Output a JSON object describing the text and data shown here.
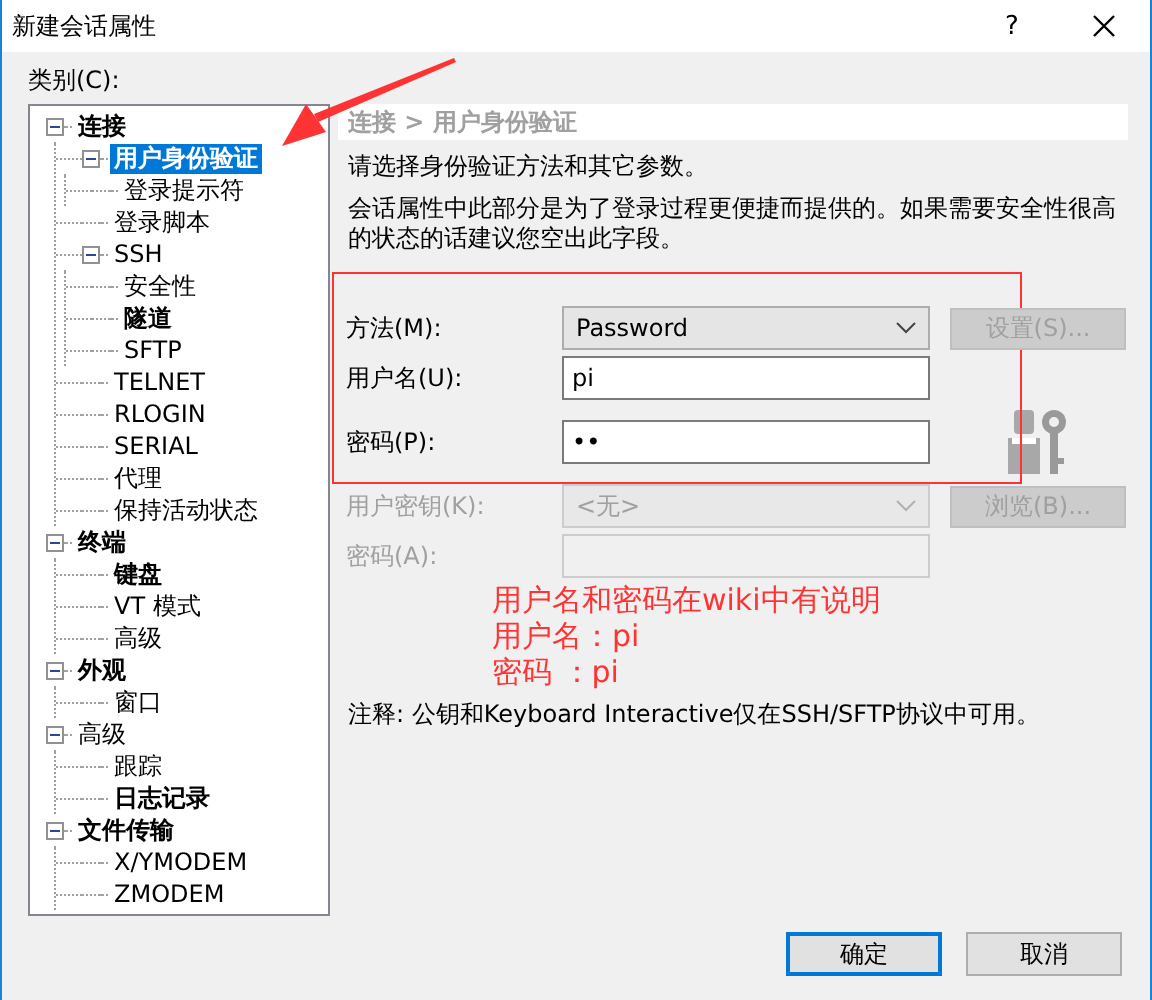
{
  "window": {
    "title": "新建会话属性",
    "help": "?"
  },
  "category_label": "类别(C):",
  "tree": [
    {
      "label": "连接",
      "bold": true,
      "selected": false,
      "expanded": true,
      "children": [
        {
          "label": "用户身份验证",
          "bold": true,
          "selected": true,
          "expanded": true,
          "children": [
            {
              "label": "登录提示符",
              "bold": false,
              "selected": false
            }
          ]
        },
        {
          "label": "登录脚本",
          "bold": false,
          "selected": false
        },
        {
          "label": "SSH",
          "bold": false,
          "selected": false,
          "expanded": true,
          "children": [
            {
              "label": "安全性",
              "bold": false,
              "selected": false
            },
            {
              "label": "隧道",
              "bold": true,
              "selected": false
            },
            {
              "label": "SFTP",
              "bold": false,
              "selected": false
            }
          ]
        },
        {
          "label": "TELNET",
          "bold": false,
          "selected": false
        },
        {
          "label": "RLOGIN",
          "bold": false,
          "selected": false
        },
        {
          "label": "SERIAL",
          "bold": false,
          "selected": false
        },
        {
          "label": "代理",
          "bold": false,
          "selected": false
        },
        {
          "label": "保持活动状态",
          "bold": false,
          "selected": false
        }
      ]
    },
    {
      "label": "终端",
      "bold": true,
      "selected": false,
      "expanded": true,
      "children": [
        {
          "label": "键盘",
          "bold": true,
          "selected": false
        },
        {
          "label": "VT 模式",
          "bold": false,
          "selected": false
        },
        {
          "label": "高级",
          "bold": false,
          "selected": false
        }
      ]
    },
    {
      "label": "外观",
      "bold": true,
      "selected": false,
      "expanded": true,
      "children": [
        {
          "label": "窗口",
          "bold": false,
          "selected": false
        }
      ]
    },
    {
      "label": "高级",
      "bold": false,
      "selected": false,
      "expanded": true,
      "children": [
        {
          "label": "跟踪",
          "bold": false,
          "selected": false
        },
        {
          "label": "日志记录",
          "bold": true,
          "selected": false
        }
      ]
    },
    {
      "label": "文件传输",
      "bold": true,
      "selected": false,
      "expanded": true,
      "children": [
        {
          "label": "X/YMODEM",
          "bold": false,
          "selected": false
        },
        {
          "label": "ZMODEM",
          "bold": false,
          "selected": false
        }
      ]
    }
  ],
  "panel": {
    "breadcrumb": "连接 > 用户身份验证",
    "description": [
      "请选择身份验证方法和其它参数。",
      "会话属性中此部分是为了登录过程更便捷而提供的。如果需要安全性很高的状态的话建议您空出此字段。"
    ],
    "rows": [
      {
        "kind": "select",
        "label": "方法(M):",
        "value": "Password",
        "disabled": false,
        "button": {
          "label": "设置(S)...",
          "disabled": true
        }
      },
      {
        "kind": "text",
        "label": "用户名(U):",
        "value": "pi",
        "disabled": false
      },
      {
        "kind": "text",
        "label": "密码(P):",
        "value": "••",
        "disabled": false
      },
      {
        "kind": "select",
        "label": "用户密钥(K):",
        "value": "<无>",
        "disabled": true,
        "button": {
          "label": "浏览(B)...",
          "disabled": true
        }
      },
      {
        "kind": "text",
        "label": "密码(A):",
        "disabled": true
      }
    ],
    "note": "注释: 公钥和Keyboard Interactive仅在SSH/SFTP协议中可用。"
  },
  "annotation": [
    "用户名和密码在wiki中有说明",
    "用户名：pi",
    "密码 ：pi"
  ],
  "buttons": [
    {
      "label": "确定",
      "default": true
    },
    {
      "label": "取消",
      "default": false
    }
  ]
}
